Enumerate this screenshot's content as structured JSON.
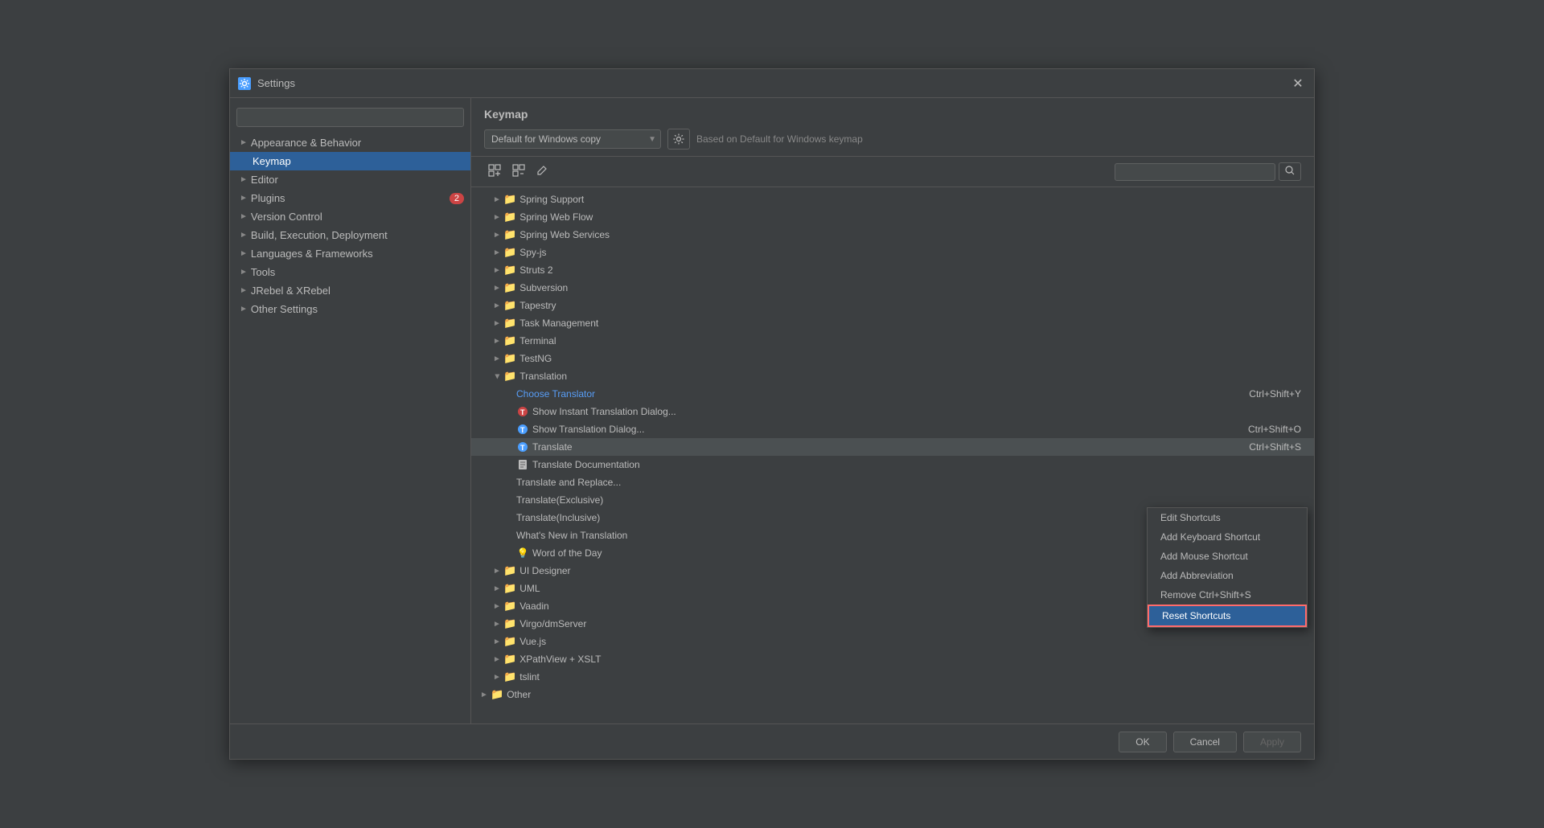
{
  "dialog": {
    "title": "Settings",
    "icon": "⚙",
    "close_label": "✕"
  },
  "sidebar": {
    "search_placeholder": "",
    "items": [
      {
        "label": "Appearance & Behavior",
        "level": 1,
        "has_chevron": true,
        "selected": false
      },
      {
        "label": "Keymap",
        "level": 2,
        "has_chevron": false,
        "selected": true
      },
      {
        "label": "Editor",
        "level": 1,
        "has_chevron": true,
        "selected": false
      },
      {
        "label": "Plugins",
        "level": 1,
        "has_chevron": true,
        "selected": false,
        "badge": "2"
      },
      {
        "label": "Version Control",
        "level": 1,
        "has_chevron": true,
        "selected": false
      },
      {
        "label": "Build, Execution, Deployment",
        "level": 1,
        "has_chevron": true,
        "selected": false
      },
      {
        "label": "Languages & Frameworks",
        "level": 1,
        "has_chevron": true,
        "selected": false
      },
      {
        "label": "Tools",
        "level": 1,
        "has_chevron": true,
        "selected": false
      },
      {
        "label": "JRebel & XRebel",
        "level": 1,
        "has_chevron": true,
        "selected": false
      },
      {
        "label": "Other Settings",
        "level": 1,
        "has_chevron": true,
        "selected": false
      }
    ]
  },
  "keymap": {
    "title": "Keymap",
    "selected_keymap": "Default for Windows copy",
    "based_on_text": "Based on Default for Windows keymap",
    "search_placeholder": ""
  },
  "tree": {
    "items": [
      {
        "label": "Spring Support",
        "indent": 1,
        "type": "folder",
        "chevron": "►"
      },
      {
        "label": "Spring Web Flow",
        "indent": 1,
        "type": "folder",
        "chevron": "►"
      },
      {
        "label": "Spring Web Services",
        "indent": 1,
        "type": "folder",
        "chevron": "►"
      },
      {
        "label": "Spy-js",
        "indent": 1,
        "type": "folder",
        "chevron": "►"
      },
      {
        "label": "Struts 2",
        "indent": 1,
        "type": "folder",
        "chevron": "►"
      },
      {
        "label": "Subversion",
        "indent": 1,
        "type": "folder",
        "chevron": "►"
      },
      {
        "label": "Tapestry",
        "indent": 1,
        "type": "folder",
        "chevron": "►"
      },
      {
        "label": "Task Management",
        "indent": 1,
        "type": "folder",
        "chevron": "►"
      },
      {
        "label": "Terminal",
        "indent": 1,
        "type": "folder",
        "chevron": "►"
      },
      {
        "label": "TestNG",
        "indent": 1,
        "type": "folder",
        "chevron": "►"
      },
      {
        "label": "Translation",
        "indent": 1,
        "type": "folder",
        "chevron": "▼",
        "expanded": true
      },
      {
        "label": "Choose Translator",
        "indent": 2,
        "type": "action",
        "is_blue": true,
        "shortcut": "Ctrl+Shift+Y"
      },
      {
        "label": "Show Instant Translation Dialog...",
        "indent": 2,
        "type": "action",
        "icon_color": "red"
      },
      {
        "label": "Show Translation Dialog...",
        "indent": 2,
        "type": "action",
        "icon_color": "blue",
        "shortcut": "Ctrl+Shift+O"
      },
      {
        "label": "Translate",
        "indent": 2,
        "type": "action",
        "icon_color": "blue",
        "selected": true,
        "shortcut": "Ctrl+Shift+S"
      },
      {
        "label": "Translate Documentation",
        "indent": 2,
        "type": "action",
        "icon_color": "doc"
      },
      {
        "label": "Translate and Replace...",
        "indent": 2,
        "type": "action"
      },
      {
        "label": "Translate(Exclusive)",
        "indent": 2,
        "type": "action"
      },
      {
        "label": "Translate(Inclusive)",
        "indent": 2,
        "type": "action"
      },
      {
        "label": "What's New in Translation",
        "indent": 2,
        "type": "action"
      },
      {
        "label": "Word of the Day",
        "indent": 2,
        "type": "action",
        "icon_color": "yellow"
      },
      {
        "label": "UI Designer",
        "indent": 1,
        "type": "folder",
        "chevron": "►"
      },
      {
        "label": "UML",
        "indent": 1,
        "type": "folder",
        "chevron": "►"
      },
      {
        "label": "Vaadin",
        "indent": 1,
        "type": "folder",
        "chevron": "►"
      },
      {
        "label": "Virgo/dmServer",
        "indent": 1,
        "type": "folder",
        "chevron": "►"
      },
      {
        "label": "Vue.js",
        "indent": 1,
        "type": "folder",
        "chevron": "►"
      },
      {
        "label": "XPathView + XSLT",
        "indent": 1,
        "type": "folder",
        "chevron": "►"
      },
      {
        "label": "tslint",
        "indent": 1,
        "type": "folder",
        "chevron": "►"
      },
      {
        "label": "Other",
        "indent": 0,
        "type": "folder",
        "chevron": "►"
      }
    ]
  },
  "context_menu": {
    "items": [
      {
        "label": "Edit Shortcuts",
        "action": "edit-shortcuts"
      },
      {
        "label": "Add Keyboard Shortcut",
        "action": "add-keyboard-shortcut"
      },
      {
        "label": "Add Mouse Shortcut",
        "action": "add-mouse-shortcut"
      },
      {
        "label": "Add Abbreviation",
        "action": "add-abbreviation"
      },
      {
        "label": "Remove Ctrl+Shift+S",
        "action": "remove-shortcut"
      },
      {
        "label": "Reset Shortcuts",
        "action": "reset-shortcuts",
        "active": true
      }
    ]
  },
  "footer": {
    "ok_label": "OK",
    "cancel_label": "Cancel",
    "apply_label": "Apply"
  },
  "toolbar": {
    "expand_all": "⇓",
    "collapse_all": "⇑",
    "edit": "✎"
  }
}
